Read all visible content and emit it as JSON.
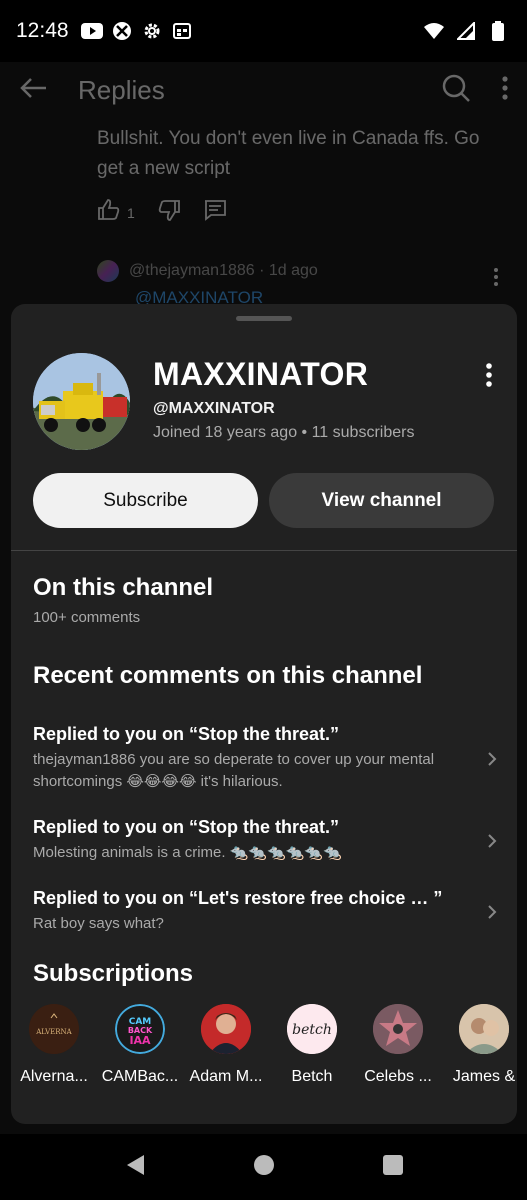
{
  "status": {
    "time": "12:48"
  },
  "background": {
    "title": "Replies",
    "reply_text": "Bullshit. You don't even live in Canada ffs. Go get a new script",
    "like_count": "1",
    "subreply_author": "@thejayman1886 · 1d ago",
    "subreply_mention": "@MAXXINATOR"
  },
  "channel": {
    "name": "MAXXINATOR",
    "handle": "@MAXXINATOR",
    "meta": "Joined 18 years ago • 11 subscribers",
    "subscribe_label": "Subscribe",
    "view_label": "View channel"
  },
  "on_channel": {
    "title": "On this channel",
    "subtitle": "100+ comments"
  },
  "recent": {
    "title": "Recent comments on this channel",
    "items": [
      {
        "title": "Replied to you on “Stop the threat.”",
        "body": "thejayman1886 you are so deperate to cover up your mental shortcomings 😂😂😂😂 it's hilarious."
      },
      {
        "title": "Replied to you on “Stop the threat.”",
        "body": "Molesting animals is a crime. 🐀🐀🐀🐀🐀🐀"
      },
      {
        "title": "Replied to you on “Let's restore free choice … ”",
        "body": "Rat boy says what?"
      }
    ]
  },
  "subscriptions": {
    "title": "Subscriptions",
    "items": [
      {
        "name": "Alverna...",
        "logo": "ALVERNA"
      },
      {
        "name": "CAMBac...",
        "logo": "CAM BACK IAA"
      },
      {
        "name": "Adam M..."
      },
      {
        "name": "Betch",
        "logo": "betch"
      },
      {
        "name": "Celebs ..."
      },
      {
        "name": "James &"
      }
    ]
  },
  "colors": {
    "accent": "#3ea6ff",
    "sheet": "#212121",
    "subscribe_bg": "#f1f1f1"
  }
}
